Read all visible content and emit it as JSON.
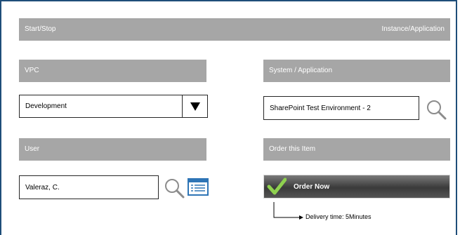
{
  "header": {
    "left_label": "Start/Stop",
    "right_label": "Instance/Application"
  },
  "vpc": {
    "label": "VPC",
    "value": "Development",
    "dropdown_icon": "triangle-down-icon"
  },
  "system": {
    "label": "System / Application",
    "value": "SharePoint Test Environment - 2",
    "search_icon": "search-icon"
  },
  "user": {
    "label": "User",
    "value": "Valeraz, C.",
    "search_icon": "search-icon",
    "list_icon": "list-icon"
  },
  "order": {
    "label": "Order this Item",
    "button_label": "Order Now",
    "button_icon": "checkmark-icon"
  },
  "delivery": {
    "text": "Delivery time: 5Minutes"
  },
  "colors": {
    "frame": "#1f4e79",
    "bar": "#a6a6a6",
    "list_icon": "#2e75b6",
    "check": "#8fd14f"
  }
}
